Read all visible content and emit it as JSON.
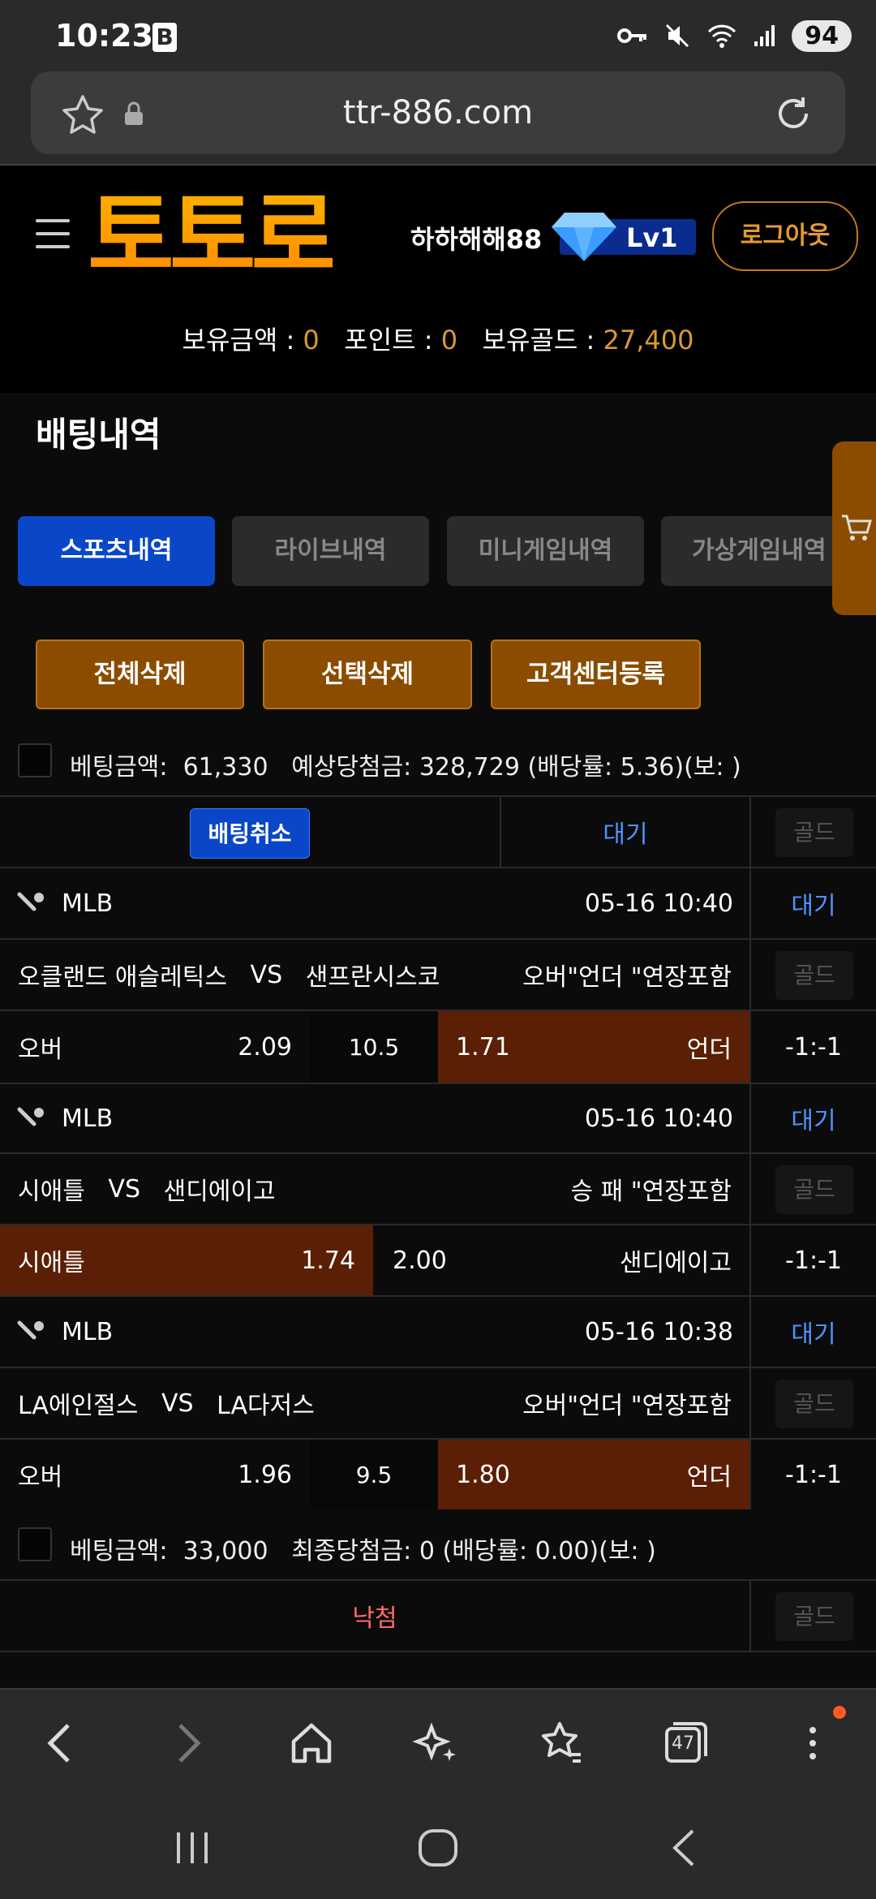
{
  "status_bar": {
    "time": "10:23",
    "b_icon": "B",
    "battery": "94"
  },
  "browser": {
    "url": "ttr-886.com",
    "tab_count": "47"
  },
  "header": {
    "logo": "토토로",
    "username": "하하해해88",
    "level": "Lv1",
    "logout_label": "로그아웃"
  },
  "balances": {
    "money_label": "보유금액 :",
    "money_value": "0",
    "point_label": "포인트 :",
    "point_value": "0",
    "gold_label": "보유골드 :",
    "gold_value": "27,400"
  },
  "page": {
    "title": "배팅내역"
  },
  "tabs": [
    {
      "label": "스포츠내역",
      "active": true
    },
    {
      "label": "라이브내역",
      "active": false
    },
    {
      "label": "미니게임내역",
      "active": false
    },
    {
      "label": "가상게임내역",
      "active": false
    }
  ],
  "actions": {
    "delete_all": "전체삭제",
    "delete_selected": "선택삭제",
    "register_cs": "고객센터등록"
  },
  "bets": [
    {
      "summary": {
        "amount_label": "베팅금액:",
        "amount": "61,330",
        "win_label": "예상당첨금:",
        "win": "328,729",
        "odds_text": "(배당률: 5.36)(보: )"
      },
      "status_row": {
        "cancel_label": "배팅취소",
        "status": "대기",
        "gold_label": "골드"
      },
      "games": [
        {
          "league": "MLB",
          "datetime": "05-16 10:40",
          "status": "대기",
          "home": "오클랜드 애슬레틱스",
          "vs": "VS",
          "away": "샌프란시스코",
          "market": "오버\"언더 \"연장포함",
          "gold_label": "골드",
          "left_label": "오버",
          "left_odds": "2.09",
          "mid": "10.5",
          "right_odds": "1.71",
          "right_label": "언더",
          "score": "-1:-1",
          "selected": "right"
        },
        {
          "league": "MLB",
          "datetime": "05-16 10:40",
          "status": "대기",
          "home": "시애틀",
          "vs": "VS",
          "away": "샌디에이고",
          "market": "승 패 \"연장포함",
          "gold_label": "골드",
          "left_label": "시애틀",
          "left_odds": "1.74",
          "mid": "",
          "right_odds": "2.00",
          "right_label": "샌디에이고",
          "score": "-1:-1",
          "selected": "left"
        },
        {
          "league": "MLB",
          "datetime": "05-16 10:38",
          "status": "대기",
          "home": "LA에인절스",
          "vs": "VS",
          "away": "LA다저스",
          "market": "오버\"언더 \"연장포함",
          "gold_label": "골드",
          "left_label": "오버",
          "left_odds": "1.96",
          "mid": "9.5",
          "right_odds": "1.80",
          "right_label": "언더",
          "score": "-1:-1",
          "selected": "right"
        }
      ]
    },
    {
      "summary": {
        "amount_label": "베팅금액:",
        "amount": "33,000",
        "win_label": "최종당첨금:",
        "win": "0",
        "odds_text": "(배당률: 0.00)(보: )"
      },
      "status_row": {
        "status": "낙첨",
        "gold_label": "골드"
      }
    }
  ],
  "colors": {
    "accent_blue": "#0a47c8",
    "brown": "#8b4c00",
    "selected_bg": "#5a1f04",
    "gold_text": "#d99a2c",
    "lost_text": "#ff6b6b"
  }
}
